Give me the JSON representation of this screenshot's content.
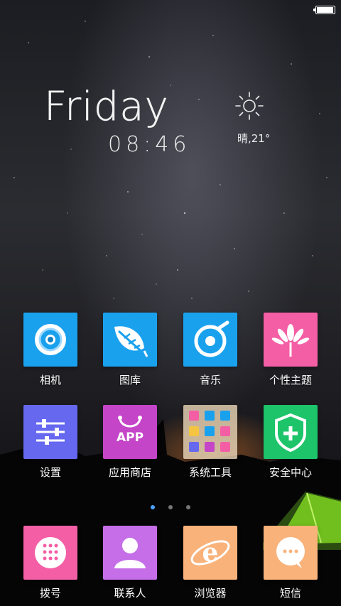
{
  "status_bar": {
    "battery_level": 0.95
  },
  "clock": {
    "day": "Friday",
    "time": "08:46"
  },
  "weather": {
    "text": "晴,21°",
    "icon": "sun-icon"
  },
  "apps_row1": [
    {
      "label": "相机",
      "icon": "camera-icon",
      "color": "#1aa1ee"
    },
    {
      "label": "图库",
      "icon": "leaf-gallery-icon",
      "color": "#1aa1ee"
    },
    {
      "label": "音乐",
      "icon": "music-disc-icon",
      "color": "#1aa1ee"
    },
    {
      "label": "个性主题",
      "icon": "flower-theme-icon",
      "color": "#f45ea5"
    }
  ],
  "apps_row2": [
    {
      "label": "设置",
      "icon": "sliders-settings-icon",
      "color": "#6668f0"
    },
    {
      "label": "应用商店",
      "icon": "shopping-bag-icon",
      "color": "#c445c8",
      "tile_text": "APP"
    },
    {
      "label": "系统工具",
      "icon": "folder-icon",
      "color": "#c9b49a"
    },
    {
      "label": "安全中心",
      "icon": "shield-plus-icon",
      "color": "#1dc46a"
    }
  ],
  "dock": [
    {
      "label": "拨号",
      "icon": "dialpad-icon",
      "color": "#f45ea5"
    },
    {
      "label": "联系人",
      "icon": "person-icon",
      "color": "#c56ee8"
    },
    {
      "label": "浏览器",
      "icon": "browser-e-icon",
      "color": "#f8b27a"
    },
    {
      "label": "短信",
      "icon": "chat-bubble-icon",
      "color": "#f8b27a"
    }
  ],
  "page_indicator": {
    "pages": 3,
    "active": 0
  }
}
